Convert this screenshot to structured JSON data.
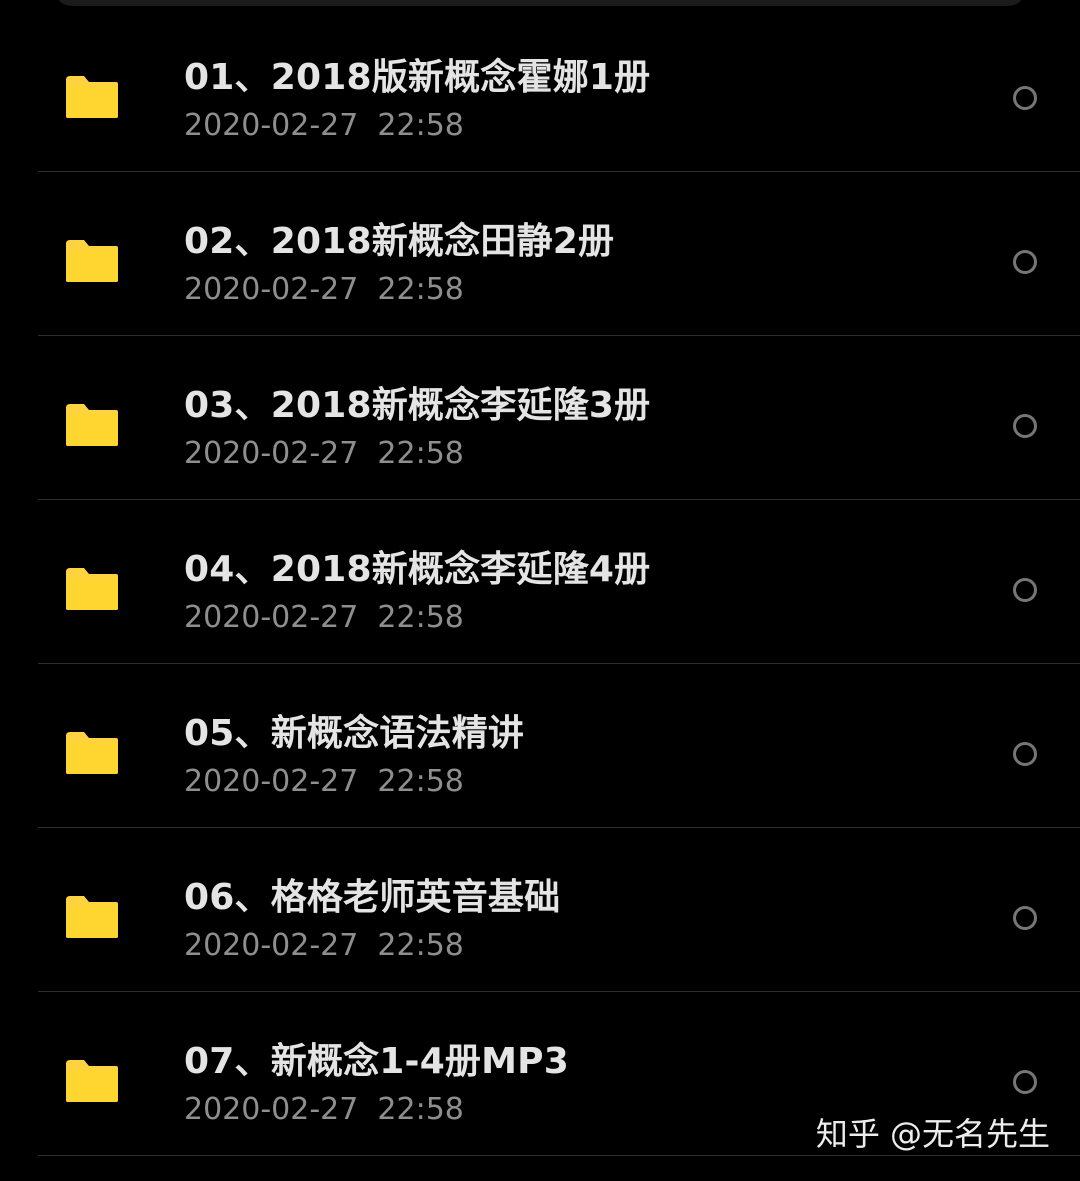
{
  "icons": {
    "folder": "folder-icon",
    "select": "radio-circle-icon"
  },
  "colors": {
    "background": "#000000",
    "folder": "#FFD23F",
    "title_text": "#E4E4E4",
    "date_text": "#8E8E8E",
    "divider": "#2E2E2E"
  },
  "files": [
    {
      "name": "01、2018版新概念霍娜1册",
      "date": "2020-02-27  22:58"
    },
    {
      "name": "02、2018新概念田静2册",
      "date": "2020-02-27  22:58"
    },
    {
      "name": "03、2018新概念李延隆3册",
      "date": "2020-02-27  22:58"
    },
    {
      "name": "04、2018新概念李延隆4册",
      "date": "2020-02-27  22:58"
    },
    {
      "name": "05、新概念语法精讲",
      "date": "2020-02-27  22:58"
    },
    {
      "name": "06、格格老师英音基础",
      "date": "2020-02-27  22:58"
    },
    {
      "name": "07、新概念1-4册MP3",
      "date": "2020-02-27  22:58"
    }
  ],
  "watermark": "知乎 @无名先生"
}
